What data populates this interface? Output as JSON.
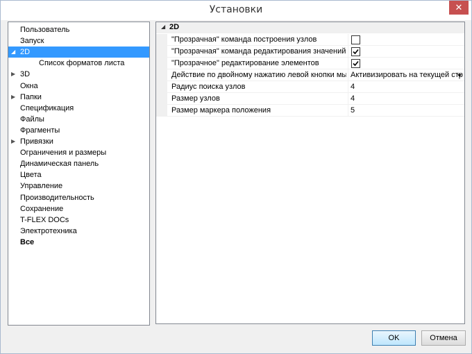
{
  "window": {
    "title": "Установки"
  },
  "tree": {
    "items": [
      {
        "label": "Пользователь",
        "indent": 0,
        "expandable": false
      },
      {
        "label": "Запуск",
        "indent": 0,
        "expandable": false
      },
      {
        "label": "2D",
        "indent": 0,
        "expandable": true,
        "expanded": true,
        "selected": true
      },
      {
        "label": "Список форматов листа",
        "indent": 1,
        "expandable": false
      },
      {
        "label": "3D",
        "indent": 0,
        "expandable": true
      },
      {
        "label": "Окна",
        "indent": 0,
        "expandable": false
      },
      {
        "label": "Папки",
        "indent": 0,
        "expandable": true
      },
      {
        "label": "Спецификация",
        "indent": 0,
        "expandable": false
      },
      {
        "label": "Файлы",
        "indent": 0,
        "expandable": false
      },
      {
        "label": "Фрагменты",
        "indent": 0,
        "expandable": false
      },
      {
        "label": "Привязки",
        "indent": 0,
        "expandable": true
      },
      {
        "label": "Ограничения и размеры",
        "indent": 0,
        "expandable": false
      },
      {
        "label": "Динамическая панель",
        "indent": 0,
        "expandable": false
      },
      {
        "label": "Цвета",
        "indent": 0,
        "expandable": false
      },
      {
        "label": "Управление",
        "indent": 0,
        "expandable": false
      },
      {
        "label": "Производительность",
        "indent": 0,
        "expandable": false
      },
      {
        "label": "Сохранение",
        "indent": 0,
        "expandable": false
      },
      {
        "label": "T-FLEX DOCs",
        "indent": 0,
        "expandable": false
      },
      {
        "label": "Электротехника",
        "indent": 0,
        "expandable": false
      },
      {
        "label": "Все",
        "indent": 0,
        "expandable": false,
        "bold": true
      }
    ]
  },
  "props": {
    "section": "2D",
    "rows": [
      {
        "name": "\"Прозрачная\" команда построения узлов",
        "type": "checkbox",
        "checked": false
      },
      {
        "name": "\"Прозрачная\" команда редактирования значений р...",
        "type": "checkbox",
        "checked": true
      },
      {
        "name": "\"Прозрачное\" редактирование элементов",
        "type": "checkbox",
        "checked": true
      },
      {
        "name": "Действие по двойному нажатию левой кнопки мы...",
        "type": "dropdown",
        "value": "Активизировать на текущей стра"
      },
      {
        "name": "Радиус поиска узлов",
        "type": "text",
        "value": "4"
      },
      {
        "name": "Размер узлов",
        "type": "text",
        "value": "4"
      },
      {
        "name": "Размер маркера положения",
        "type": "text",
        "value": "5"
      }
    ]
  },
  "buttons": {
    "ok": "OK",
    "cancel": "Отмена"
  },
  "colors": {
    "selection": "#3399ff",
    "close": "#c75050"
  }
}
